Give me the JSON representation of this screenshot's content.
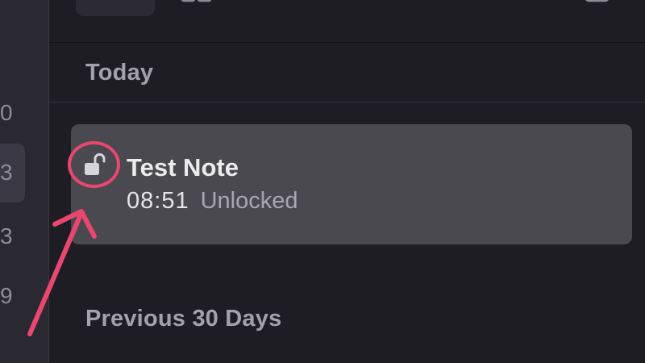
{
  "sidebar": {
    "counts": [
      "0",
      "3",
      "3",
      "9"
    ]
  },
  "notes_list": {
    "sections": [
      {
        "label": "Today"
      },
      {
        "label": "Previous 30 Days"
      }
    ],
    "selected_note": {
      "title": "Test Note",
      "time": "08:51",
      "status": "Unlocked",
      "lock_icon": "open-padlock-icon"
    }
  },
  "colors": {
    "background": "#1f1d24",
    "sidebar": "#2a2830",
    "selected_row": "#4a4950",
    "annotation": "#ea4770"
  }
}
